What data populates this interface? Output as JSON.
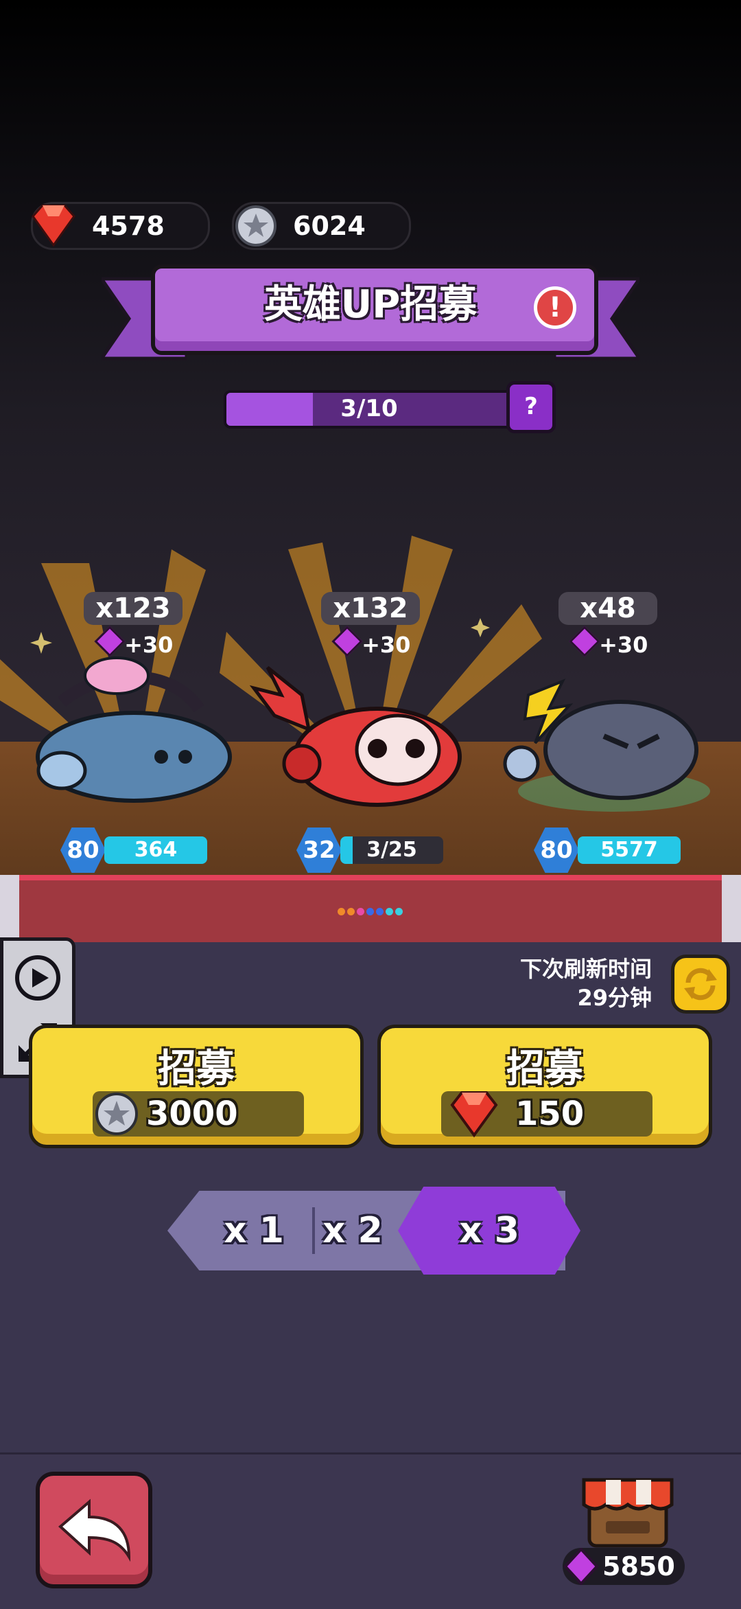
{
  "currencies": {
    "gems": "4578",
    "coins": "6024"
  },
  "banner": {
    "title": "英雄UP招募",
    "alert": "!"
  },
  "progress": {
    "text": "3/10",
    "value": 0.3,
    "help": "?"
  },
  "heroes": [
    {
      "count": "x123",
      "bonus": "+30",
      "level": "80",
      "exp": "364",
      "exp_fill": 1.0
    },
    {
      "count": "x132",
      "bonus": "+30",
      "level": "32",
      "exp": "3/25",
      "exp_fill": 0.12
    },
    {
      "count": "x48",
      "bonus": "+30",
      "level": "80",
      "exp": "5577",
      "exp_fill": 1.0
    }
  ],
  "refresh": {
    "line1": "下次刷新时间",
    "line2": "29分钟"
  },
  "recruit_coin": {
    "label": "招募",
    "cost": "3000"
  },
  "recruit_gem": {
    "label": "招募",
    "cost": "150"
  },
  "multipliers": [
    "x 1",
    "x 2",
    "x 3"
  ],
  "multiplier_selected": "x 3",
  "shop": {
    "gems": "5850"
  },
  "colors": {
    "banner_purple": "#b26ad8",
    "progress_purple": "#a553e0",
    "button_yellow": "#f7d93a",
    "exp_cyan": "#25c7e6",
    "back_red": "#d04a5e"
  }
}
